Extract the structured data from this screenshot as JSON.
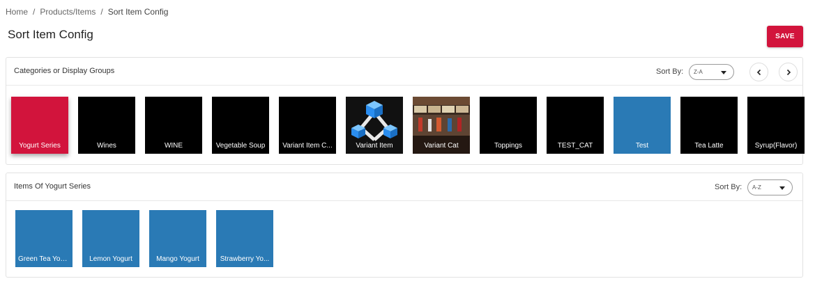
{
  "breadcrumb": {
    "home": "Home",
    "sep1": "/",
    "products": "Products/Items",
    "sep2": "/",
    "current": "Sort Item Config"
  },
  "page_title": "Sort Item Config",
  "save_label": "SAVE",
  "categories_panel": {
    "title": "Categories or Display Groups",
    "sort_label": "Sort By:",
    "sort_value": "Z-A",
    "tiles": [
      {
        "label": "Yogurt Series",
        "color": "#d2143c",
        "selected": true
      },
      {
        "label": "Wines",
        "color": "#000000"
      },
      {
        "label": "WINE",
        "color": "#000000"
      },
      {
        "label": "Vegetable Soup",
        "color": "#000000"
      },
      {
        "label": "Variant Item C...",
        "color": "#000000"
      },
      {
        "label": "Variant Item",
        "color": "#000000",
        "image": "cubes-image"
      },
      {
        "label": "Variant Cat",
        "color": "#000000",
        "image": "store-photo"
      },
      {
        "label": "Toppings",
        "color": "#000000"
      },
      {
        "label": "TEST_CAT",
        "color": "#000000"
      },
      {
        "label": "Test",
        "color": "#2a7ab5"
      },
      {
        "label": "Tea Latte",
        "color": "#000000"
      },
      {
        "label": "Syrup(Flavor)",
        "color": "#000000"
      }
    ]
  },
  "items_panel": {
    "title": "Items Of Yogurt Series",
    "sort_label": "Sort By:",
    "sort_value": "A-Z",
    "tiles": [
      {
        "label": "Green Tea Yog...",
        "color": "#2a7ab5"
      },
      {
        "label": "Lemon Yogurt",
        "color": "#2a7ab5"
      },
      {
        "label": "Mango Yogurt",
        "color": "#2a7ab5"
      },
      {
        "label": "Strawberry Yo...",
        "color": "#2a7ab5"
      }
    ]
  },
  "icons": {
    "prev": "chevron-left-icon",
    "next": "chevron-right-icon",
    "caret": "caret-down-icon"
  }
}
